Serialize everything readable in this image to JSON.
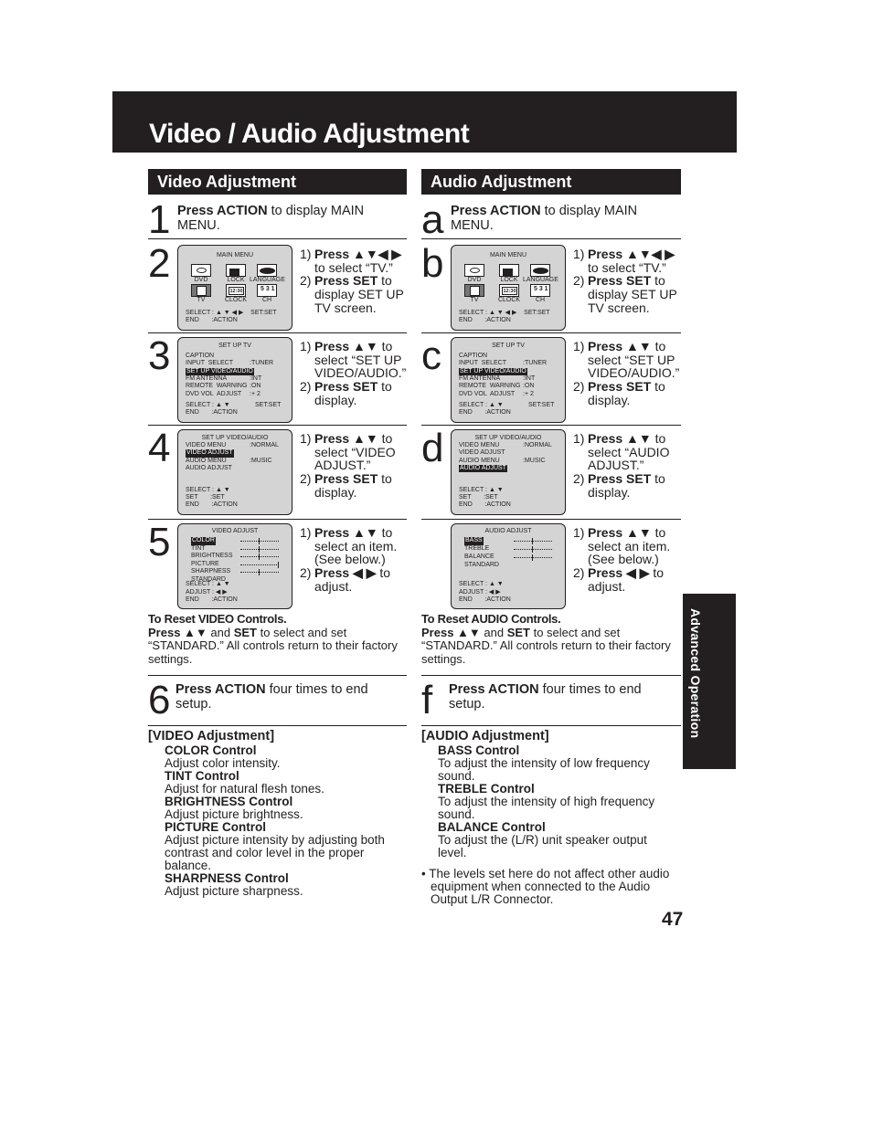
{
  "page": {
    "title": "Video / Audio Adjustment",
    "side_tab": "Advanced Operation",
    "page_number": "47"
  },
  "video": {
    "header": "Video Adjustment",
    "steps": [
      {
        "num": "1",
        "bold": "Press ACTION",
        "rest": " to display MAIN MENU."
      },
      {
        "num": "2",
        "lines": [
          {
            "n": "1)",
            "bold": "Press ▲▼◀ ▶",
            "rest": ""
          },
          {
            "n": "",
            "bold": "",
            "rest": "to select “TV.”"
          },
          {
            "n": "2)",
            "bold": "Press SET",
            "rest": " to"
          },
          {
            "n": "",
            "bold": "",
            "rest": "display SET UP"
          },
          {
            "n": "",
            "bold": "",
            "rest": "TV screen."
          }
        ]
      },
      {
        "num": "3",
        "lines": [
          {
            "n": "1)",
            "bold": "Press ▲▼",
            "rest": " to"
          },
          {
            "n": "",
            "bold": "",
            "rest": "select “SET UP"
          },
          {
            "n": "",
            "bold": "",
            "rest": "VIDEO/AUDIO.”"
          },
          {
            "n": "2)",
            "bold": "Press SET",
            "rest": " to"
          },
          {
            "n": "",
            "bold": "",
            "rest": "display."
          }
        ]
      },
      {
        "num": "4",
        "lines": [
          {
            "n": "1)",
            "bold": "Press ▲▼",
            "rest": " to"
          },
          {
            "n": "",
            "bold": "",
            "rest": "select “VIDEO"
          },
          {
            "n": "",
            "bold": "",
            "rest": "ADJUST.”"
          },
          {
            "n": "2)",
            "bold": "Press SET",
            "rest": " to"
          },
          {
            "n": "",
            "bold": "",
            "rest": "display."
          }
        ]
      },
      {
        "num": "5",
        "lines": [
          {
            "n": "1)",
            "bold": "Press ▲▼",
            "rest": " to"
          },
          {
            "n": "",
            "bold": "",
            "rest": "select an item."
          },
          {
            "n": "",
            "bold": "",
            "rest": "(See below.)"
          },
          {
            "n": "2)",
            "bold": "Press ◀ ▶",
            "rest": " to"
          },
          {
            "n": "",
            "bold": "",
            "rest": "adjust."
          }
        ]
      },
      {
        "num": "6",
        "bold": "Press ACTION",
        "rest": " four times to end setup."
      }
    ],
    "reset": {
      "heading": "To Reset VIDEO Controls.",
      "press": "Press ▲▼",
      "and": " and ",
      "set": "SET",
      "rest": " to select and set “STANDARD.” All controls return to their factory settings."
    },
    "desc_heading": "[VIDEO Adjustment]",
    "controls": [
      {
        "name": "COLOR Control",
        "text": "Adjust color intensity."
      },
      {
        "name": "TINT Control",
        "text": "Adjust for natural flesh tones."
      },
      {
        "name": "BRIGHTNESS Control",
        "text": "Adjust picture brightness."
      },
      {
        "name": "PICTURE Control",
        "text": "Adjust picture intensity by adjusting both contrast and color level in the proper balance."
      },
      {
        "name": "SHARPNESS Control",
        "text": "Adjust picture sharpness."
      }
    ]
  },
  "audio": {
    "header": "Audio Adjustment",
    "steps": [
      {
        "num": "a",
        "bold": "Press ACTION",
        "rest": " to display MAIN MENU."
      },
      {
        "num": "b",
        "lines": [
          {
            "n": "1)",
            "bold": "Press ▲▼◀ ▶",
            "rest": ""
          },
          {
            "n": "",
            "bold": "",
            "rest": "to select “TV.”"
          },
          {
            "n": "2)",
            "bold": "Press SET",
            "rest": " to"
          },
          {
            "n": "",
            "bold": "",
            "rest": "display SET UP"
          },
          {
            "n": "",
            "bold": "",
            "rest": "TV screen."
          }
        ]
      },
      {
        "num": "c",
        "lines": [
          {
            "n": "1)",
            "bold": "Press ▲▼",
            "rest": " to"
          },
          {
            "n": "",
            "bold": "",
            "rest": "select “SET UP"
          },
          {
            "n": "",
            "bold": "",
            "rest": "VIDEO/AUDIO.”"
          },
          {
            "n": "2)",
            "bold": "Press SET",
            "rest": " to"
          },
          {
            "n": "",
            "bold": "",
            "rest": "display."
          }
        ]
      },
      {
        "num": "d",
        "lines": [
          {
            "n": "1)",
            "bold": "Press ▲▼",
            "rest": " to"
          },
          {
            "n": "",
            "bold": "",
            "rest": "select “AUDIO"
          },
          {
            "n": "",
            "bold": "",
            "rest": "ADJUST.”"
          },
          {
            "n": "2)",
            "bold": "Press SET",
            "rest": " to"
          },
          {
            "n": "",
            "bold": "",
            "rest": "display."
          }
        ]
      },
      {
        "num": "",
        "lines": [
          {
            "n": "1)",
            "bold": "Press ▲▼",
            "rest": " to"
          },
          {
            "n": "",
            "bold": "",
            "rest": "select an item."
          },
          {
            "n": "",
            "bold": "",
            "rest": "(See below.)"
          },
          {
            "n": "2)",
            "bold": "Press ◀ ▶",
            "rest": " to"
          },
          {
            "n": "",
            "bold": "",
            "rest": "adjust."
          }
        ]
      },
      {
        "num": "f",
        "bold": "Press ACTION",
        "rest": " four times to end setup."
      }
    ],
    "reset": {
      "heading": "To Reset AUDIO Controls.",
      "press": "Press ▲▼",
      "and": " and ",
      "set": "SET",
      "rest": " to select and set “STANDARD.” All controls return to their factory settings."
    },
    "desc_heading": "[AUDIO Adjustment]",
    "controls": [
      {
        "name": "BASS Control",
        "text": "To adjust the intensity of low frequency sound."
      },
      {
        "name": "TREBLE Control",
        "text": "To adjust the intensity of high frequency sound."
      },
      {
        "name": "BALANCE Control",
        "text": "To adjust the (L/R) unit speaker output level."
      }
    ],
    "note": "• The levels set here do not affect other audio equipment when connected to the Audio Output L/R Connector."
  },
  "osd": {
    "main_menu": {
      "title": "MAIN MENU",
      "icons": [
        "DVD",
        "LOCK",
        "LANGUAGE",
        "TV",
        "CLOCK",
        "CH"
      ],
      "clock_text": "12:30",
      "ch_text": "5 3 1",
      "footer1": "SELECT : ▲ ▼ ◀ ▶    SET:SET",
      "footer2": "END       :ACTION"
    },
    "setup_tv": {
      "title": "SET UP TV",
      "rows": [
        {
          "label": "CAPTION",
          "value": ""
        },
        {
          "label": "INPUT  SELECT",
          "value": ":TUNER"
        },
        {
          "label": "SET UP VIDEO/AUDIO",
          "value": "",
          "highlight": true
        },
        {
          "label": "FM ANTENNA",
          "value": ":INT"
        },
        {
          "label": "REMOTE  WARNING",
          "value": ":ON"
        },
        {
          "label": "DVD VOL  ADJUST",
          "value": ":+ 2"
        }
      ],
      "footer1": "SELECT : ▲ ▼",
      "footer1_right": "SET:SET",
      "footer2": "END       :ACTION"
    },
    "setup_va": {
      "title": "SET UP VIDEO/AUDIO",
      "rows": [
        {
          "label": "VIDEO MENU",
          "value": ":NORMAL"
        },
        {
          "label": "VIDEO ADJUST",
          "value": ""
        },
        {
          "label": "AUDIO MENU",
          "value": ":MUSIC"
        },
        {
          "label": "AUDIO ADJUST",
          "value": ""
        }
      ],
      "footer1": "SELECT : ▲ ▼",
      "footer2": "SET       :SET",
      "footer3": "END       :ACTION"
    },
    "video_adjust": {
      "title": "VIDEO ADJUST",
      "rows": [
        {
          "label": "COLOR",
          "level": 0.5
        },
        {
          "label": "TINT",
          "level": 0.5
        },
        {
          "label": "BRIGHTNESS",
          "level": 0.5
        },
        {
          "label": "PICTURE",
          "level": 1.0
        },
        {
          "label": "SHARPNESS",
          "level": 0.5
        },
        {
          "label": "STANDARD",
          "level": null
        }
      ],
      "footer1": "SELECT : ▲ ▼",
      "footer2": "ADJUST : ◀ ▶",
      "footer3": "END       :ACTION"
    },
    "audio_adjust": {
      "title": "AUDIO ADJUST",
      "rows": [
        {
          "label": "BASS",
          "level": 0.5
        },
        {
          "label": "TREBLE",
          "level": 0.5
        },
        {
          "label": "BALANCE",
          "level": 0.5
        },
        {
          "label": "STANDARD",
          "level": null
        }
      ],
      "footer1": "SELECT : ▲ ▼",
      "footer2": "ADJUST : ◀ ▶",
      "footer3": "END       :ACTION"
    }
  }
}
